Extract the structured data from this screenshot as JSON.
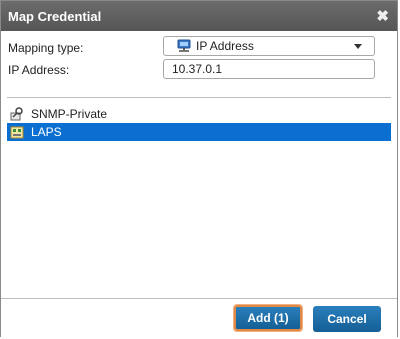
{
  "dialog": {
    "title": "Map Credential",
    "close_glyph": "✖"
  },
  "form": {
    "mapping_type_label": "Mapping type:",
    "mapping_type_value": "IP Address",
    "mapping_type_icon": "network-computer-icon",
    "ip_label": "IP Address:",
    "ip_value": "10.37.0.1"
  },
  "list": {
    "items": [
      {
        "label": "SNMP-Private",
        "icon": "snmp-credential-icon",
        "selected": false
      },
      {
        "label": "LAPS",
        "icon": "laps-credential-icon",
        "selected": true
      }
    ]
  },
  "footer": {
    "add_label": "Add (1)",
    "cancel_label": "Cancel"
  },
  "colors": {
    "titlebar": "#5f5f5f",
    "selection": "#0a6fd0",
    "button": "#1f6fa8",
    "highlight_outline": "#e08a4a"
  }
}
